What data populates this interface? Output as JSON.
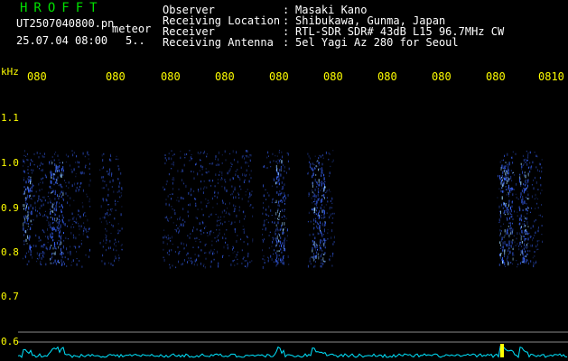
{
  "header": {
    "app_title": "HROFFT",
    "filename": "UT2507040800.pn",
    "mode": "meteor",
    "datetime": "25.07.04 08:00",
    "count": "5.."
  },
  "info": [
    {
      "label": "Observer",
      "value": "Masaki Kano"
    },
    {
      "label": "Receiving Location",
      "value": "Shibukawa, Gunma, Japan"
    },
    {
      "label": "Receiver",
      "value": "RTL-SDR SDR# 43dB L15 96.7MHz CW"
    },
    {
      "label": "Receiving Antenna",
      "value": "5el Yagi Az 280 for Seoul"
    }
  ],
  "colon": ":",
  "axis": {
    "y_unit": "kHz",
    "time_ticks": [
      "080",
      "080",
      "080",
      "080",
      "080",
      "080",
      "080",
      "080",
      "080",
      "0810"
    ],
    "freq_ticks": [
      "1.1",
      "1.0",
      "0.9",
      "0.8",
      "0.7",
      "0.6"
    ]
  },
  "colors": {
    "title": "#00e000",
    "text": "#ffffff",
    "axis": "#ffff00",
    "echo": "#3a66ff",
    "echo_bright": "#9fd8ff",
    "level": "#00e5ff",
    "level_peak": "#ffff00",
    "guide_line": "#8a8a8a"
  }
}
